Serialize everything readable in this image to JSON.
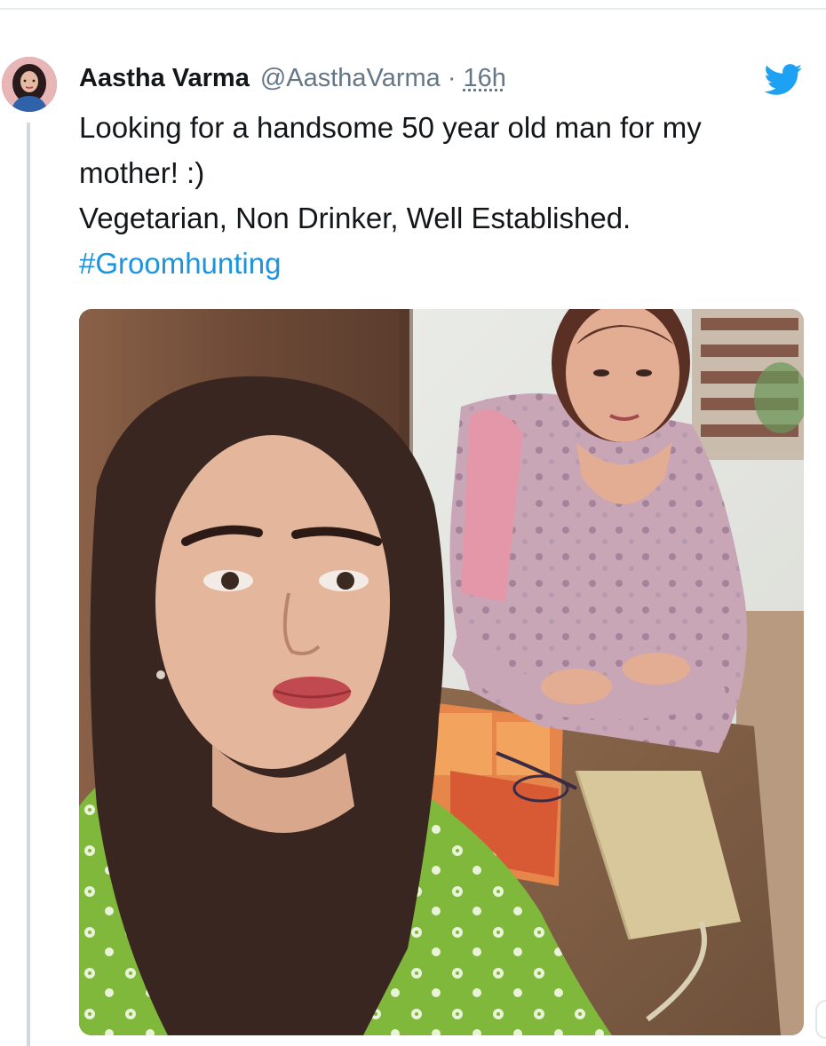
{
  "tweet": {
    "display_name": "Aastha Varma",
    "handle": "@AasthaVarma",
    "separator": "·",
    "time": "16h",
    "text_lines": [
      "Looking for a handsome 50 year old man for my",
      "mother! :)",
      "Vegetarian, Non Drinker, Well Established."
    ],
    "hashtag": "#Groomhunting"
  },
  "icons": {
    "platform": "twitter-bird-icon"
  },
  "colors": {
    "text": "#14171a",
    "muted": "#657786",
    "link": "#1b95e0",
    "brand": "#1da1f2",
    "thread_line": "#cfd9de"
  },
  "media": {
    "type": "photo"
  }
}
